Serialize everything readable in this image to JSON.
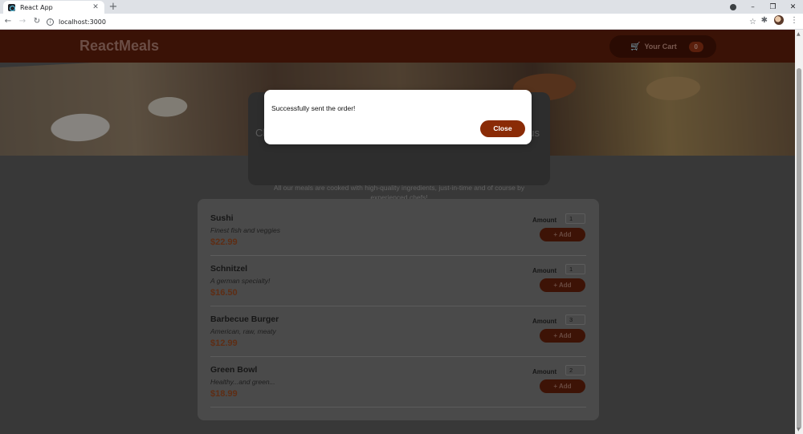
{
  "browser": {
    "tab_title": "React App",
    "tab_close": "✕",
    "new_tab": "+",
    "url": "localhost:3000",
    "window_controls": {
      "minimize": "–",
      "restore": "❐",
      "close": "✕"
    }
  },
  "header": {
    "brand": "ReactMeals",
    "cart": {
      "label": "Your Cart",
      "count": "0"
    }
  },
  "summary": {
    "title_fragment": "Ch",
    "title_fragment_end": "us",
    "text": "All our meals are cooked with high-quality ingredients, just-in-time and of course by experienced chefs!"
  },
  "meals": [
    {
      "name": "Sushi",
      "description": "Finest fish and veggies",
      "price": "$22.99",
      "amount_label": "Amount",
      "amount": "1",
      "add_label": "+ Add"
    },
    {
      "name": "Schnitzel",
      "description": "A german specialty!",
      "price": "$16.50",
      "amount_label": "Amount",
      "amount": "1",
      "add_label": "+ Add"
    },
    {
      "name": "Barbecue Burger",
      "description": "American, raw, meaty",
      "price": "$12.99",
      "amount_label": "Amount",
      "amount": "3",
      "add_label": "+ Add"
    },
    {
      "name": "Green Bowl",
      "description": "Healthy...and green...",
      "price": "$18.99",
      "amount_label": "Amount",
      "amount": "2",
      "add_label": "+ Add"
    }
  ],
  "modal": {
    "message": "Successfully sent the order!",
    "close_label": "Close"
  },
  "colors": {
    "accent": "#8a2b06",
    "header_bg": "#3a1206",
    "page_bg": "#383838"
  }
}
